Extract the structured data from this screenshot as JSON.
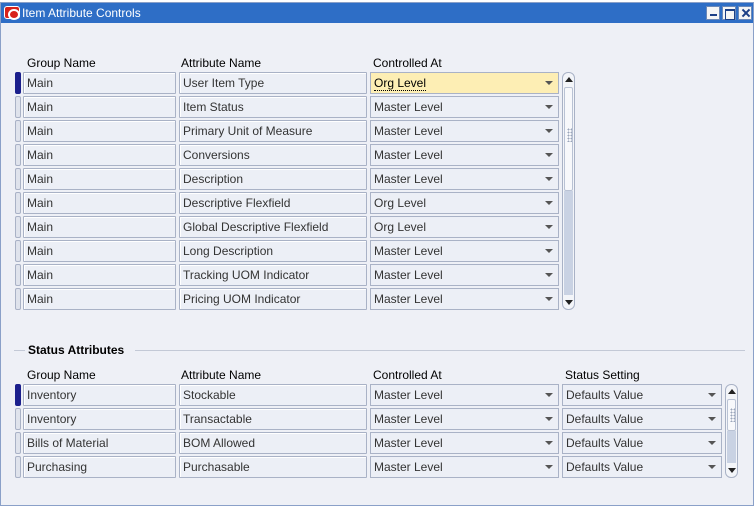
{
  "window": {
    "title": "Item Attribute Controls",
    "logo_icon": "oracle-logo-icon",
    "buttons": [
      "minimize",
      "maximize",
      "close"
    ]
  },
  "main_table": {
    "headers": {
      "group_name": "Group Name",
      "attribute_name": "Attribute Name",
      "controlled_at": "Controlled At"
    },
    "rows": [
      {
        "group": "Main",
        "attribute": "User Item Type",
        "controlled_at": "Org Level",
        "active": true
      },
      {
        "group": "Main",
        "attribute": "Item Status",
        "controlled_at": "Master Level",
        "active": false
      },
      {
        "group": "Main",
        "attribute": "Primary Unit of Measure",
        "controlled_at": "Master Level",
        "active": false
      },
      {
        "group": "Main",
        "attribute": "Conversions",
        "controlled_at": "Master Level",
        "active": false
      },
      {
        "group": "Main",
        "attribute": "Description",
        "controlled_at": "Master Level",
        "active": false
      },
      {
        "group": "Main",
        "attribute": "Descriptive Flexfield",
        "controlled_at": "Org Level",
        "active": false
      },
      {
        "group": "Main",
        "attribute": "Global Descriptive Flexfield",
        "controlled_at": "Org Level",
        "active": false
      },
      {
        "group": "Main",
        "attribute": "Long Description",
        "controlled_at": "Master Level",
        "active": false
      },
      {
        "group": "Main",
        "attribute": "Tracking UOM Indicator",
        "controlled_at": "Master Level",
        "active": false
      },
      {
        "group": "Main",
        "attribute": "Pricing UOM Indicator",
        "controlled_at": "Master Level",
        "active": false
      }
    ]
  },
  "status_section": {
    "title": "Status Attributes",
    "headers": {
      "group_name": "Group Name",
      "attribute_name": "Attribute Name",
      "controlled_at": "Controlled At",
      "status_setting": "Status Setting"
    },
    "rows": [
      {
        "group": "Inventory",
        "attribute": "Stockable",
        "controlled_at": "Master Level",
        "status_setting": "Defaults Value"
      },
      {
        "group": "Inventory",
        "attribute": "Transactable",
        "controlled_at": "Master Level",
        "status_setting": "Defaults Value"
      },
      {
        "group": "Bills of Material",
        "attribute": "BOM Allowed",
        "controlled_at": "Master Level",
        "status_setting": "Defaults Value"
      },
      {
        "group": "Purchasing",
        "attribute": "Purchasable",
        "controlled_at": "Master Level",
        "status_setting": "Defaults Value"
      }
    ]
  },
  "colors": {
    "titlebar": "#2e6ec6",
    "active_field": "#fdeeb4",
    "current_row_indicator": "#1b1f8c"
  }
}
